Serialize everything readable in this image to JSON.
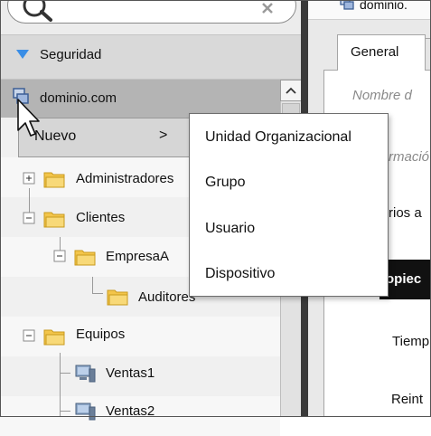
{
  "sidebar": {
    "section_label": "Seguridad",
    "tree": {
      "domain": "dominio.com",
      "items": [
        {
          "label": "Administradores"
        },
        {
          "label": "Clientes"
        },
        {
          "label": "EmpresaA"
        },
        {
          "label": "Auditores"
        },
        {
          "label": "Equipos"
        },
        {
          "label": "Ventas1"
        },
        {
          "label": "Ventas2"
        }
      ]
    }
  },
  "context_menu": {
    "item_label": "Nuevo",
    "arrow": ">",
    "submenu": [
      "Unidad Organizacional",
      "Grupo",
      "Usuario",
      "Dispositivo"
    ]
  },
  "right_panel": {
    "header_title": "dominio.",
    "tab_general": "General",
    "name_label": "Nombre d",
    "info_label": "rmació",
    "users_label": "rios a",
    "properties_label": "opiec",
    "tiempo_label": "Tiemp",
    "reint_label": "Reint"
  },
  "icons": {
    "search": "search-icon",
    "clear": "close-icon",
    "section": "triangle-down-icon",
    "domain": "domain-icon",
    "folder": "folder-icon",
    "computer": "computer-icon",
    "expand": "plus-box-icon",
    "collapse": "minus-box-icon",
    "cursor": "mouse-pointer-icon"
  },
  "colors": {
    "accent": "#3a8ee6",
    "folder": "#f3c54a"
  }
}
